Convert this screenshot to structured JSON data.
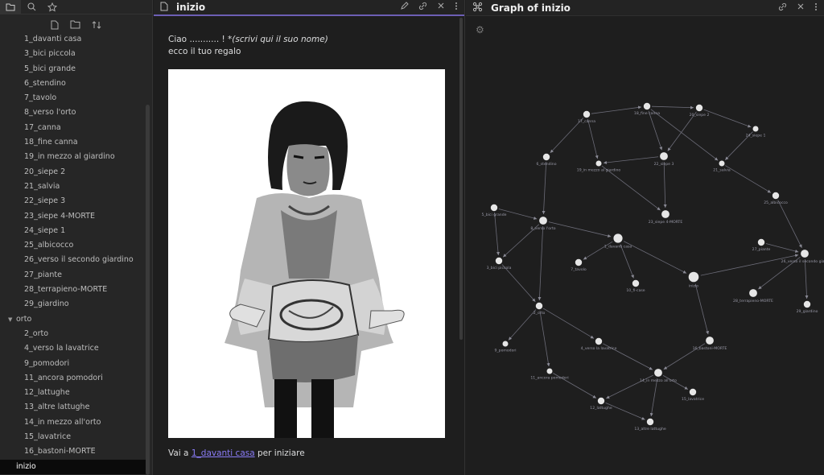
{
  "sidebar": {
    "tabs": [
      {
        "icon": "folder-icon"
      },
      {
        "icon": "search-icon"
      },
      {
        "icon": "star-icon"
      }
    ],
    "tools": [
      {
        "icon": "new-note-icon"
      },
      {
        "icon": "new-folder-icon"
      },
      {
        "icon": "sort-icon"
      }
    ],
    "files": [
      "1_davanti casa",
      "3_bici piccola",
      "5_bici grande",
      "6_stendino",
      "7_tavolo",
      "8_verso l'orto",
      "17_canna",
      "18_fine canna",
      "19_in mezzo al giardino",
      "20_siepe 2",
      "21_salvia",
      "22_siepe 3",
      "23_siepe 4-MORTE",
      "24_siepe 1",
      "25_albicocco",
      "26_verso il secondo giardino",
      "27_piante",
      "28_terrapieno-MORTE",
      "29_giardino"
    ],
    "folder": "orto",
    "folder_files": [
      "2_orto",
      "4_verso la lavatrice",
      "9_pomodori",
      "11_ancora pomodori",
      "12_lattughe",
      "13_altre lattughe",
      "14_in mezzo all'orto",
      "15_lavatrice",
      "16_bastoni-MORTE"
    ],
    "active_file": "inizio"
  },
  "editor": {
    "title": "inizio",
    "line1_prefix": "Ciao ........... ! *",
    "line1_italic": "(scrivi qui il suo nome)",
    "line2": "ecco il tuo regalo",
    "bottom_prefix": "Vai a ",
    "bottom_link": "1_davanti casa",
    "bottom_suffix": " per iniziare",
    "icons": [
      "edit-icon",
      "link-icon",
      "close-icon",
      "more-icon"
    ]
  },
  "graph": {
    "title": "Graph of inizio",
    "nodes": [
      {
        "id": "17_canna",
        "label": "17_canna"
      },
      {
        "id": "18_fine canna",
        "label": "18_fine canna"
      },
      {
        "id": "20_siepe 2",
        "label": "20_siepe 2"
      },
      {
        "id": "24_siepe 1",
        "label": "24_siepe 1"
      },
      {
        "id": "6_stendino",
        "label": "6_stendino"
      },
      {
        "id": "19_in mezzo al giardino",
        "label": "19_in mezzo al giardino"
      },
      {
        "id": "22_siepe 3",
        "label": "22_siepe 3"
      },
      {
        "id": "21_salvia",
        "label": "21_salvia"
      },
      {
        "id": "25_albicocco",
        "label": "25_albicocco"
      },
      {
        "id": "5_bici grande",
        "label": "5_bici grande"
      },
      {
        "id": "8_verso l'orto",
        "label": "8_verso l'orto"
      },
      {
        "id": "23_siepe 4-MORTE",
        "label": "23_siepe 4-MORTE"
      },
      {
        "id": "1_davanti casa",
        "label": "1_davanti casa"
      },
      {
        "id": "27_piante",
        "label": "27_piante"
      },
      {
        "id": "26_verso il secondo giardino",
        "label": "26_verso il secondo giard"
      },
      {
        "id": "3_bici piccola",
        "label": "3_bici piccola"
      },
      {
        "id": "7_tavolo",
        "label": "7_tavolo"
      },
      {
        "id": "10_fi-case",
        "label": "10_fi-case"
      },
      {
        "id": "inizio",
        "label": "inizio"
      },
      {
        "id": "28_terrapieno-MORTE",
        "label": "28_terrapieno-MORTE"
      },
      {
        "id": "29_giardino",
        "label": "29_giardino"
      },
      {
        "id": "2_orto",
        "label": "2_orto"
      },
      {
        "id": "9_pomodori",
        "label": "9_pomodori"
      },
      {
        "id": "4_verso la lavatrice",
        "label": "4_verso la lavatrice"
      },
      {
        "id": "16_bastoni-MORTE",
        "label": "16_bastoni-MORTE"
      },
      {
        "id": "11_ancora pomodori",
        "label": "11_ancora pomodori"
      },
      {
        "id": "14_in mezzo all'orto",
        "label": "14_in mezzo all'orto"
      },
      {
        "id": "15_lavatrice",
        "label": "15_lavatrice"
      },
      {
        "id": "12_lattughe",
        "label": "12_lattughe"
      },
      {
        "id": "13_altre lattughe",
        "label": "13_altre lattughe"
      }
    ],
    "edges": [
      [
        "17_canna",
        "18_fine canna"
      ],
      [
        "18_fine canna",
        "20_siepe 2"
      ],
      [
        "20_siepe 2",
        "22_siepe 3"
      ],
      [
        "24_siepe 1",
        "21_salvia"
      ],
      [
        "17_canna",
        "6_stendino"
      ],
      [
        "17_canna",
        "19_in mezzo al giardino"
      ],
      [
        "18_fine canna",
        "22_siepe 3"
      ],
      [
        "18_fine canna",
        "21_salvia"
      ],
      [
        "20_siepe 2",
        "24_siepe 1"
      ],
      [
        "22_siepe 3",
        "19_in mezzo al giardino"
      ],
      [
        "19_in mezzo al giardino",
        "23_siepe 4-MORTE"
      ],
      [
        "22_siepe 3",
        "23_siepe 4-MORTE"
      ],
      [
        "21_salvia",
        "25_albicocco"
      ],
      [
        "25_albicocco",
        "26_verso il secondo giardino"
      ],
      [
        "6_stendino",
        "8_verso l'orto"
      ],
      [
        "5_bici grande",
        "8_verso l'orto"
      ],
      [
        "5_bici grande",
        "3_bici piccola"
      ],
      [
        "8_verso l'orto",
        "3_bici piccola"
      ],
      [
        "8_verso l'orto",
        "1_davanti casa"
      ],
      [
        "1_davanti casa",
        "7_tavolo"
      ],
      [
        "1_davanti casa",
        "10_fi-case"
      ],
      [
        "1_davanti casa",
        "inizio"
      ],
      [
        "inizio",
        "26_verso il secondo giardino"
      ],
      [
        "27_piante",
        "26_verso il secondo giardino"
      ],
      [
        "26_verso il secondo giardino",
        "28_terrapieno-MORTE"
      ],
      [
        "26_verso il secondo giardino",
        "29_giardino"
      ],
      [
        "8_verso l'orto",
        "2_orto"
      ],
      [
        "3_bici piccola",
        "2_orto"
      ],
      [
        "inizio",
        "16_bastoni-MORTE"
      ],
      [
        "2_orto",
        "9_pomodori"
      ],
      [
        "2_orto",
        "4_verso la lavatrice"
      ],
      [
        "2_orto",
        "11_ancora pomodori"
      ],
      [
        "4_verso la lavatrice",
        "14_in mezzo all'orto"
      ],
      [
        "16_bastoni-MORTE",
        "14_in mezzo all'orto"
      ],
      [
        "14_in mezzo all'orto",
        "15_lavatrice"
      ],
      [
        "11_ancora pomodori",
        "12_lattughe"
      ],
      [
        "14_in mezzo all'orto",
        "12_lattughe"
      ],
      [
        "14_in mezzo all'orto",
        "13_altre lattughe"
      ],
      [
        "12_lattughe",
        "13_altre lattughe"
      ]
    ]
  }
}
